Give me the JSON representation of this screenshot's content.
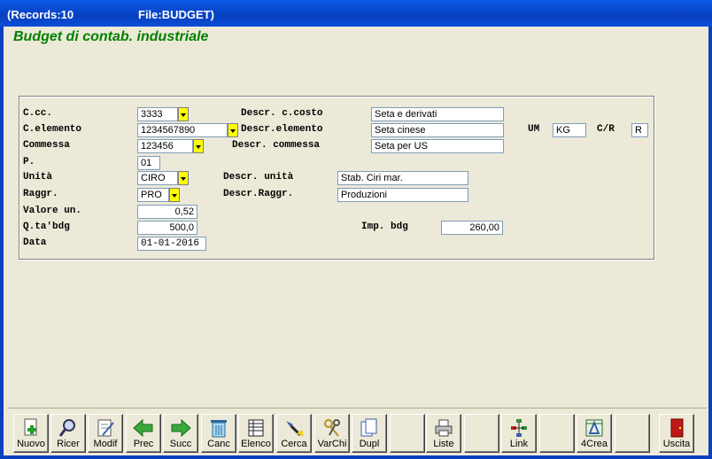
{
  "window": {
    "records": "(Records:10",
    "file": "File:BUDGET)"
  },
  "form": {
    "title": "Budget di contab. industriale"
  },
  "labels": {
    "ccc": "C.cc.",
    "celemento": "C.elemento",
    "commessa": "Commessa",
    "p": "P.",
    "unita": "Unità",
    "raggr": "Raggr.",
    "valore": "Valore un.",
    "qta": "Q.ta'bdg",
    "data": "Data",
    "descr_costo": "Descr. c.costo",
    "descr_elemento": "Descr.elemento",
    "descr_commessa": "Descr. commessa",
    "descr_unita": "Descr. unità",
    "descr_raggr": "Descr.Raggr.",
    "um": "UM",
    "cr": "C/R",
    "imp": "Imp. bdg"
  },
  "fields": {
    "ccc": "3333",
    "celemento": "1234567890",
    "commessa": "123456",
    "p": "01",
    "unita": "CIRO",
    "raggr": "PRO",
    "valore": "0,52",
    "qta": "500,0",
    "data": "01-01-2016",
    "descr_costo": "Seta e derivati",
    "descr_elemento": "Seta cinese",
    "descr_commessa": "Seta per US",
    "descr_unita": "Stab. Ciri mar.",
    "descr_raggr": "Produzioni",
    "um": "KG",
    "cr": "R",
    "imp": "260,00"
  },
  "toolbar": [
    "Nuovo",
    "Ricer",
    "Modif",
    "Prec",
    "Succ",
    "Canc",
    "Elenco",
    "Cerca",
    "VarChi",
    "Dupl",
    "",
    "Liste",
    "",
    "Link",
    "",
    "4Crea",
    "",
    "Uscita"
  ]
}
